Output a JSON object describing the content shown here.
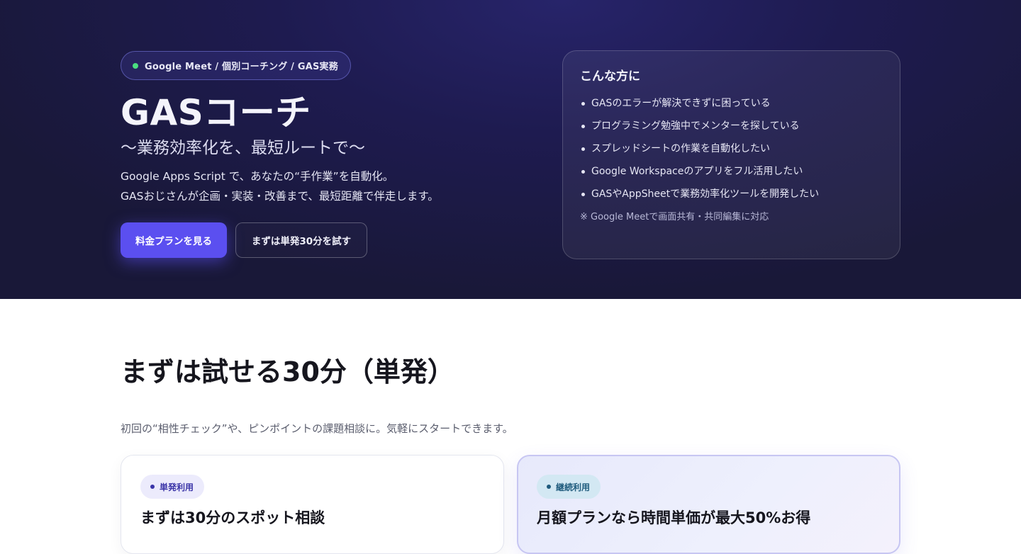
{
  "hero": {
    "badge_text": "Google Meet / 個別コーチング / GAS実務",
    "title": "GASコーチ",
    "subtitle": "〜業務効率化を、最短ルートで〜",
    "description_line1": "Google Apps Script で、あなたの“手作業”を自動化。",
    "description_line2": "GASおじさんが企画・実装・改善まで、最短距離で伴走します。",
    "primary_button": "料金プランを見る",
    "secondary_button": "まずは単発30分を試す"
  },
  "target": {
    "title": "こんな方に",
    "items": [
      "GASのエラーが解決できずに困っている",
      "プログラミング勉強中でメンターを探している",
      "スプレッドシートの作業を自動化したい",
      "Google Workspaceのアプリをフル活用したい",
      "GASやAppSheetで業務効率化ツールを開発したい"
    ],
    "note": "※ Google Meetで画面共有・共同編集に対応"
  },
  "trial": {
    "title": "まずは試せる30分（単発）",
    "description": "初回の“相性チェック”や、ピンポイントの課題相談に。気軽にスタートできます。",
    "cards": [
      {
        "tag": "単発利用",
        "name": "まずは30分のスポット相談"
      },
      {
        "tag": "継続利用",
        "name": "月額プランなら時間単価が最大50%お得"
      }
    ]
  },
  "colors": {
    "hero_bg": "#1e1b50",
    "accent": "#5b4ff0",
    "status_dot": "#4ade80"
  }
}
